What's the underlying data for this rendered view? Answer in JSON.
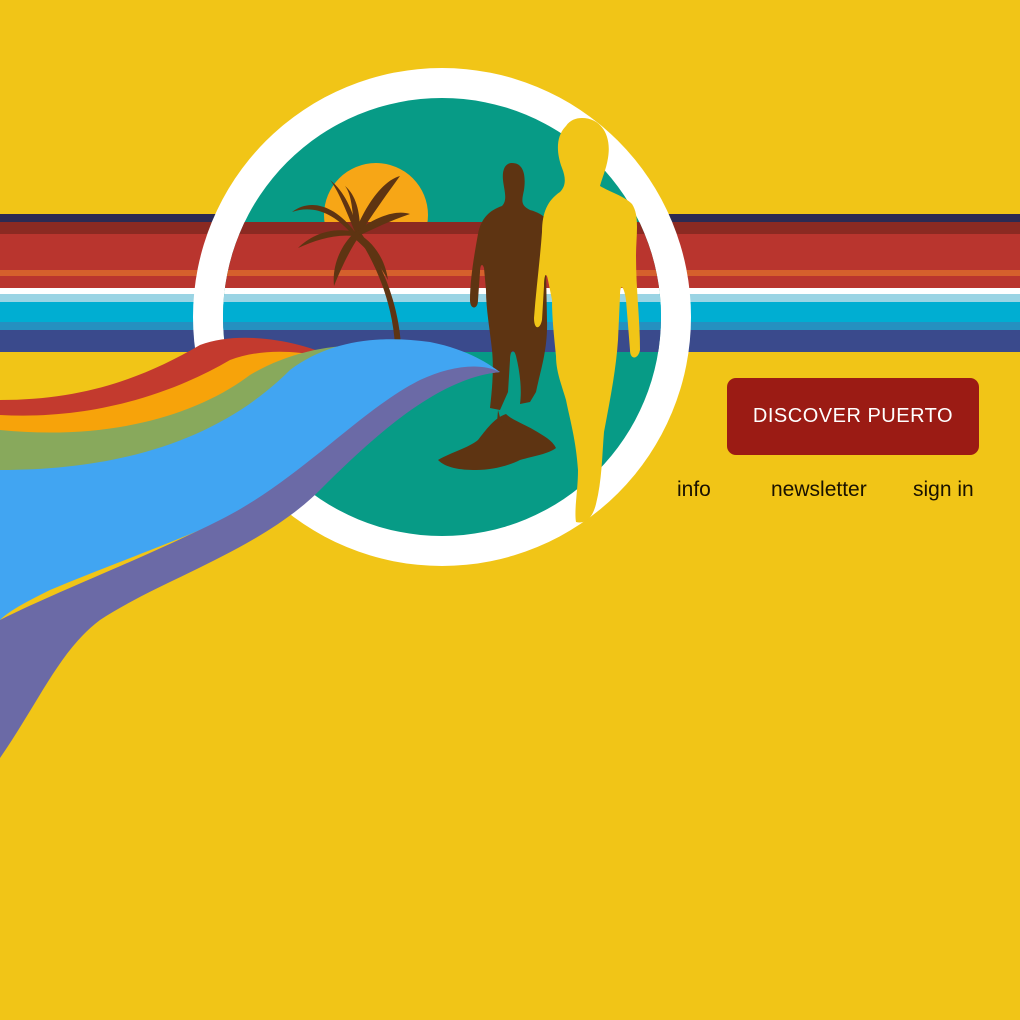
{
  "hero": {
    "cta_label": "DISCOVER PUERTO"
  },
  "nav": {
    "items": [
      {
        "label": "info",
        "icon": ""
      },
      {
        "label": "newsletter",
        "icon": ""
      },
      {
        "label": "sign in",
        "icon": ""
      }
    ]
  },
  "colors": {
    "background": "#f1c517",
    "cta": "#9b1b14",
    "circle_fill": "#079b86",
    "sun": "#f7a616",
    "silhouette_dark": "#5e3412",
    "silhouette_light": "#f1c517"
  }
}
